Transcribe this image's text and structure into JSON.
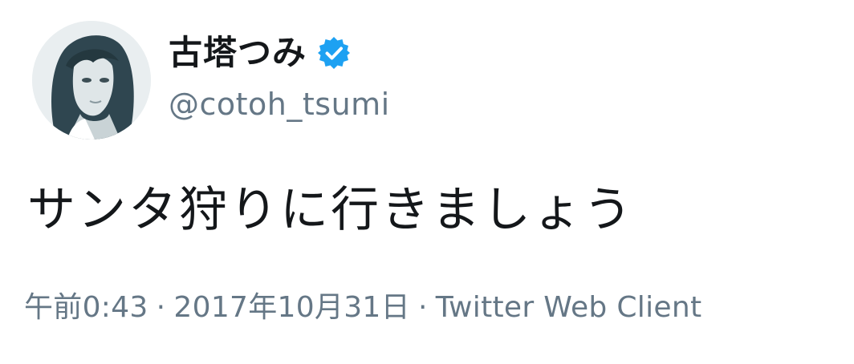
{
  "user": {
    "display_name": "古塔つみ",
    "handle": "@cotoh_tsumi",
    "verified": true,
    "verified_badge_color": "#1da1f2",
    "avatar_icon": "avatar-illustration-portrait"
  },
  "tweet": {
    "text": "サンタ狩りに行きましょう"
  },
  "meta": {
    "time": "午前0:43",
    "separator": "·",
    "date": "2017年10月31日",
    "source": "Twitter Web Client"
  },
  "colors": {
    "text_primary": "#14171a",
    "text_secondary": "#657786",
    "background": "#ffffff"
  }
}
